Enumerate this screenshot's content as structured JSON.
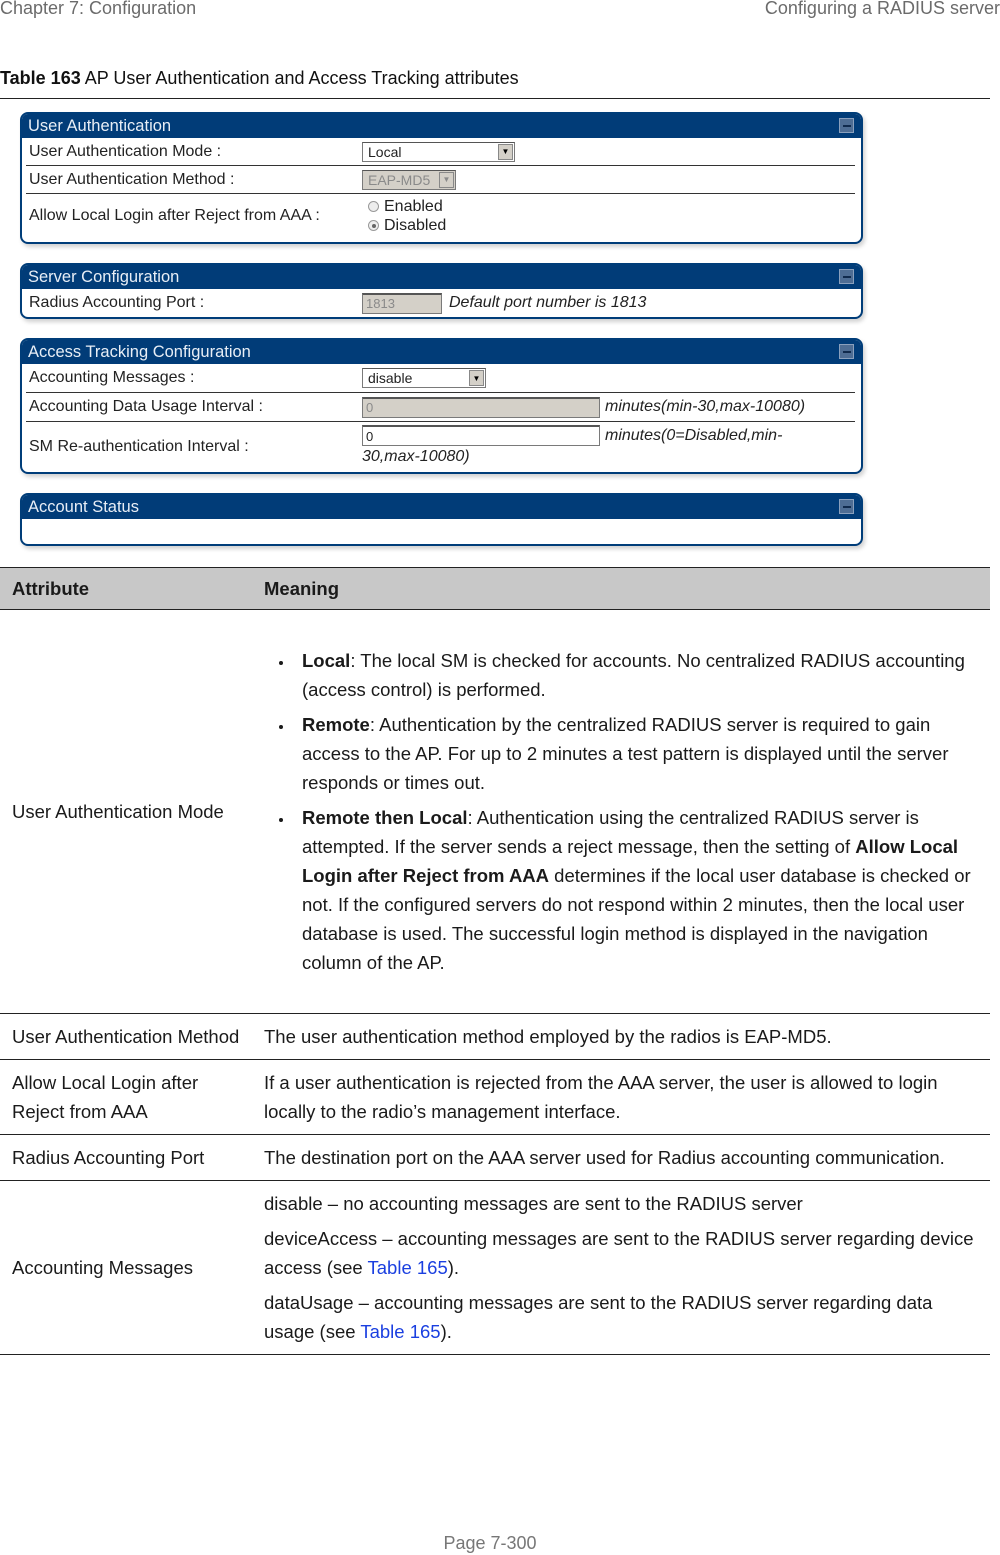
{
  "header": {
    "chapter": "Chapter 7:  Configuration",
    "section": "Configuring a RADIUS server"
  },
  "caption": {
    "label": "Table 163",
    "text": " AP User Authentication and Access Tracking attributes"
  },
  "screenshot": {
    "user_auth": {
      "title": "User Authentication",
      "mode_label": "User Authentication Mode :",
      "mode_value": "Local",
      "method_label": "User Authentication Method :",
      "method_value": "EAP-MD5",
      "allow_label": "Allow Local Login after Reject from AAA :",
      "allow_options": [
        "Enabled",
        "Disabled"
      ],
      "allow_selected": "Disabled"
    },
    "server_config": {
      "title": "Server Configuration",
      "port_label": "Radius Accounting Port :",
      "port_value": "1813",
      "port_hint": "Default port number is 1813"
    },
    "access_tracking": {
      "title": "Access Tracking Configuration",
      "messages_label": "Accounting Messages :",
      "messages_value": "disable",
      "usage_label": "Accounting Data Usage Interval :",
      "usage_value": "0",
      "usage_hint": "minutes(min-30,max-10080)",
      "reauth_label": "SM Re-authentication Interval :",
      "reauth_value": "0",
      "reauth_hint_1": "minutes(0=Disabled,min-",
      "reauth_hint_2": "30,max-10080)"
    },
    "account_status": {
      "title": "Account Status"
    }
  },
  "table": {
    "headers": [
      "Attribute",
      "Meaning"
    ],
    "rows": [
      {
        "attribute": "User Authentication Mode",
        "bullets": [
          {
            "term": "Local",
            "text": ": The local SM is checked for accounts. No centralized RADIUS accounting (access control) is performed."
          },
          {
            "term": "Remote",
            "text": ": Authentication by the centralized RADIUS server is required to gain access to the AP. For up to 2 minutes a test pattern is displayed until the server responds or times out."
          },
          {
            "term": "Remote then Local",
            "text": ": Authentication using the centralized RADIUS server is attempted. If the server sends a reject message, then the setting of ",
            "bold2": "Allow Local Login after Reject from AAA",
            "text2": " determines if the local user database is checked or not. If the configured servers do not respond within 2 minutes, then the local user database is used. The successful login method is displayed in the navigation column of the AP."
          }
        ]
      },
      {
        "attribute": "User Authentication Method",
        "meaning": "The user authentication method employed by the radios is EAP-MD5."
      },
      {
        "attribute": "Allow Local Login after Reject from AAA",
        "meaning": "If a user authentication is rejected from the AAA server, the user is allowed to login locally to the radio’s management interface."
      },
      {
        "attribute": "Radius Accounting Port",
        "meaning": "The destination port on the AAA server used for Radius accounting communication."
      },
      {
        "attribute": "Accounting Messages",
        "paragraphs": [
          {
            "text": "disable – no accounting messages are sent to the RADIUS server"
          },
          {
            "text": "deviceAccess – accounting messages are sent to the RADIUS server regarding device access (see ",
            "link": "Table 165",
            "after": ")."
          },
          {
            "text": "dataUsage – accounting messages are sent to the RADIUS server regarding data usage (see ",
            "link": "Table 165",
            "after": ")."
          }
        ]
      }
    ]
  },
  "footer": {
    "page": "Page 7-300"
  }
}
